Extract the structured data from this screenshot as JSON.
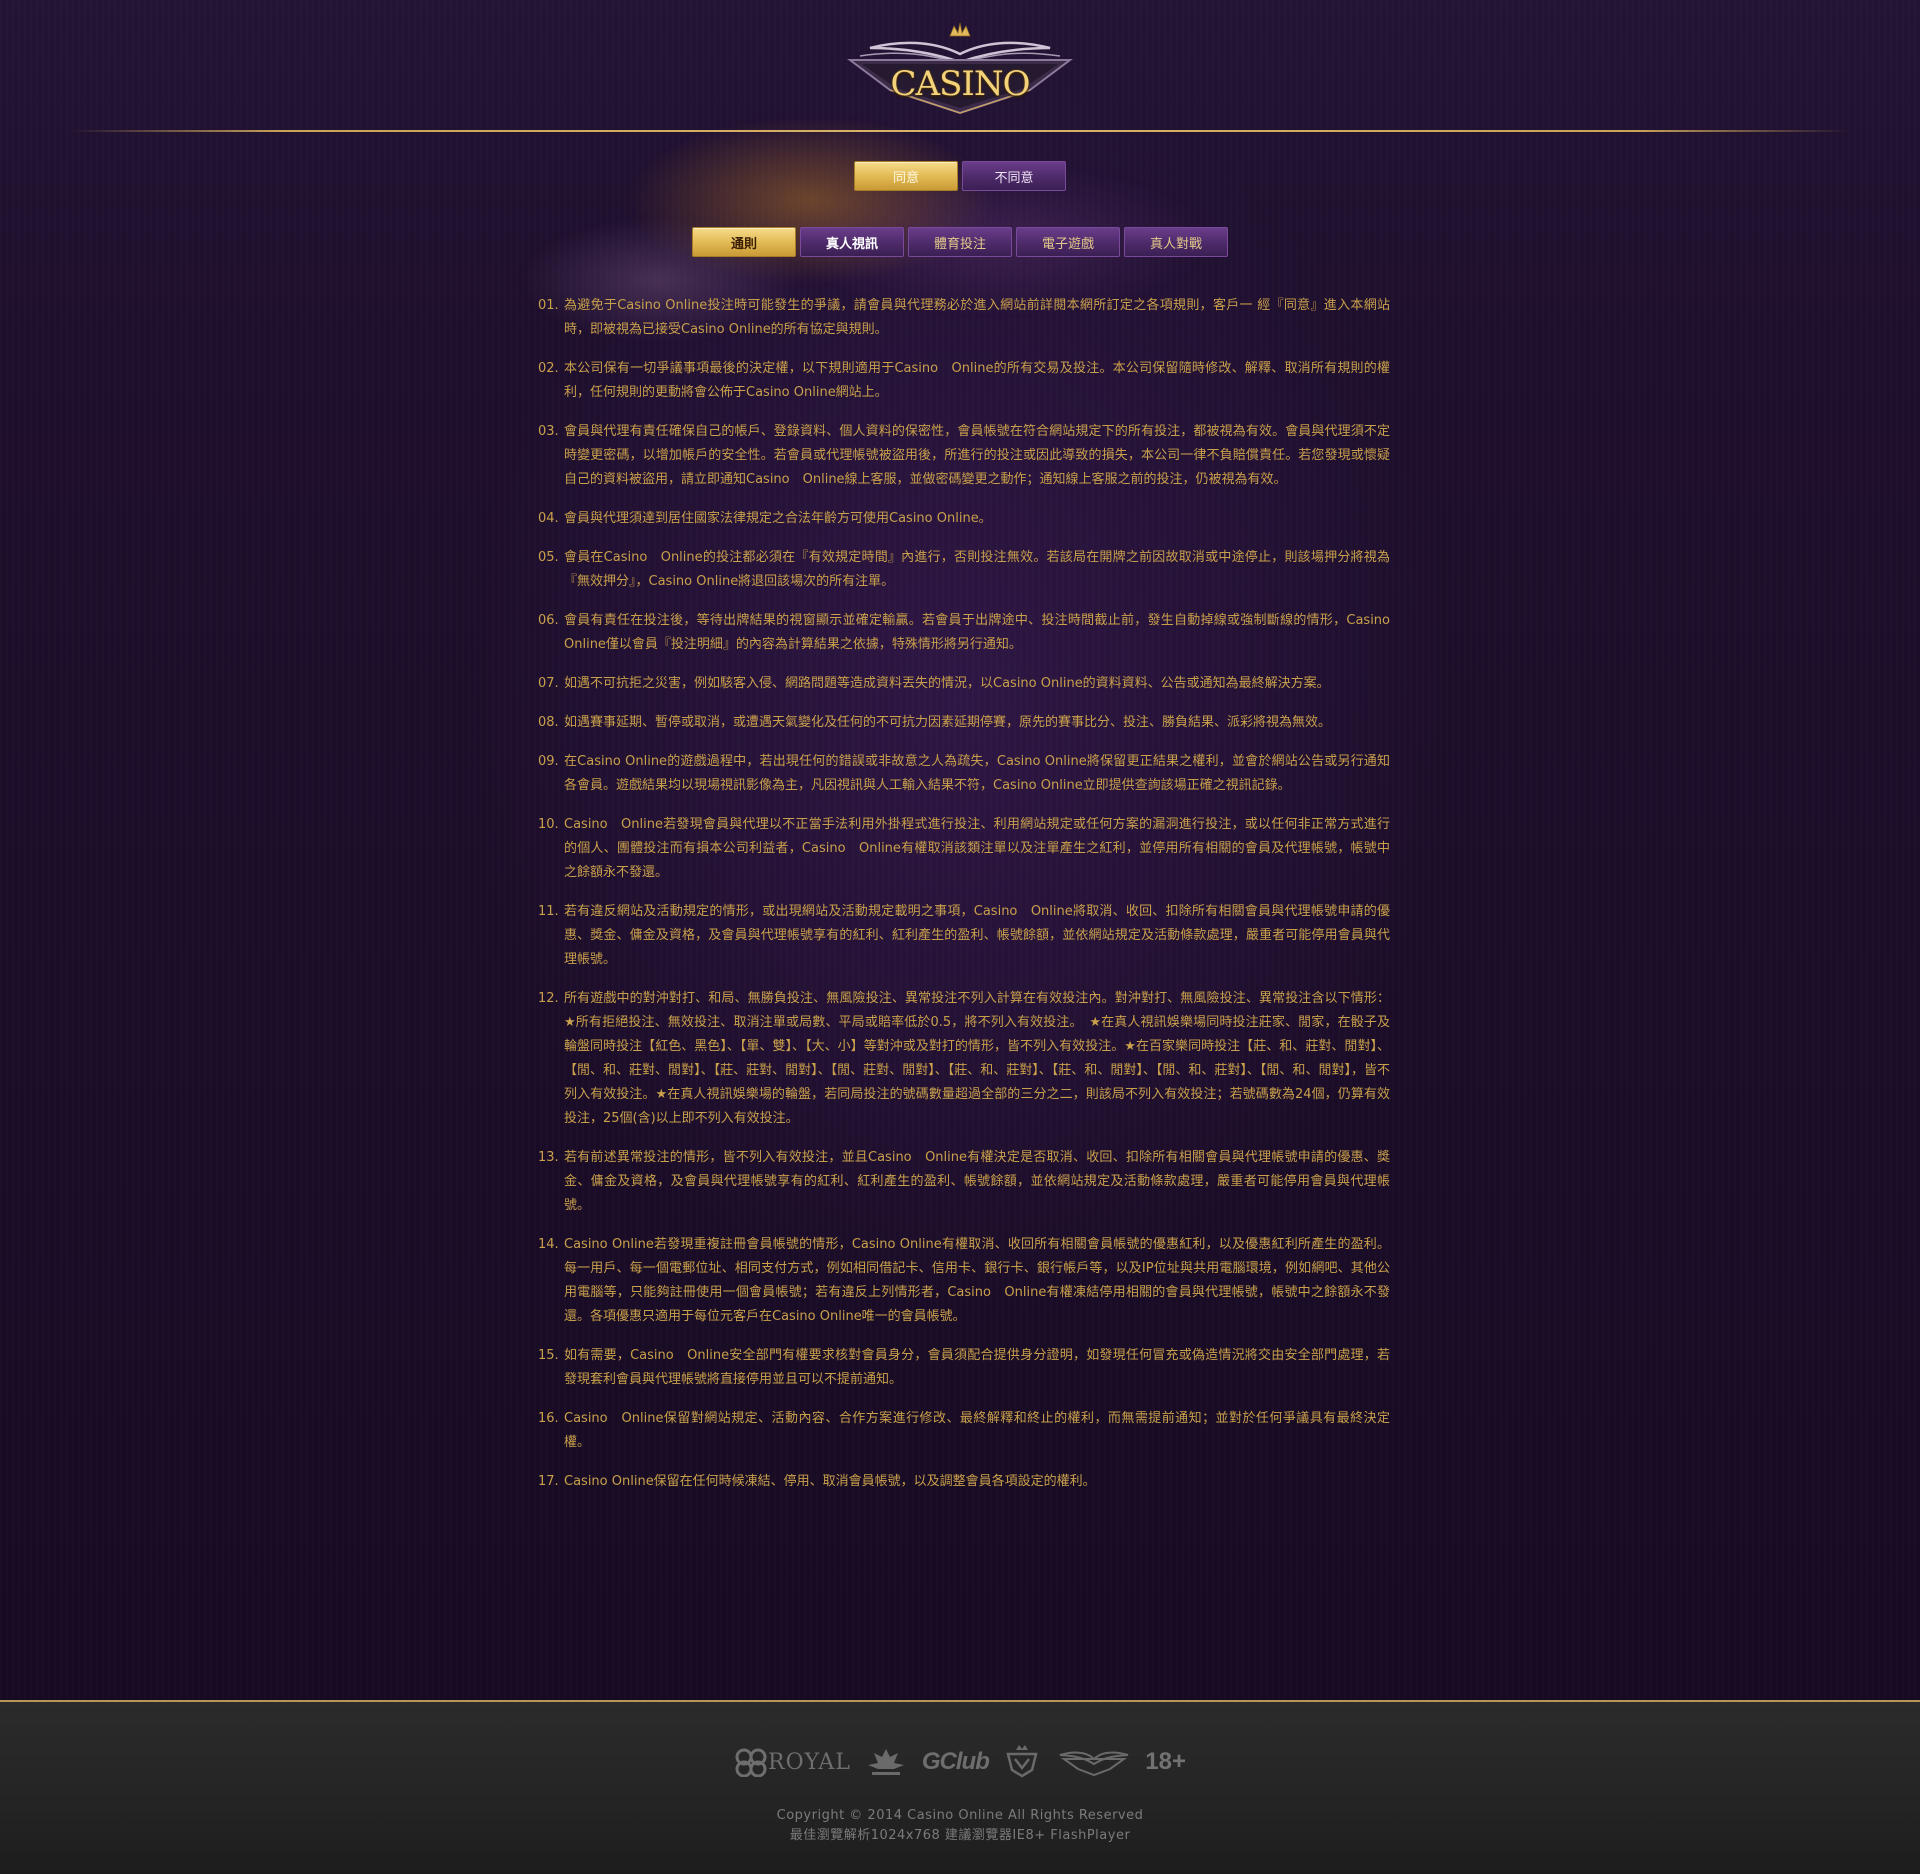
{
  "header": {
    "logo_text": "CASINO"
  },
  "actions": {
    "agree": "同意",
    "disagree": "不同意"
  },
  "tabs": [
    {
      "label": "通則"
    },
    {
      "label": "真人視訊"
    },
    {
      "label": "體育投注"
    },
    {
      "label": "電子遊戲"
    },
    {
      "label": "真人對戰"
    }
  ],
  "rules": [
    {
      "num": "01.",
      "text": "為避免于Casino Online投注時可能發生的爭議，請會員與代理務必於進入網站前詳閱本網所訂定之各項規則，客戶一 經『同意』進入本網站時，即被視為已接受Casino Online的所有協定與規則。"
    },
    {
      "num": "02.",
      "text": "本公司保有一切爭議事項最後的決定權，以下規則適用于Casino　Online的所有交易及投注。本公司保留隨時修改、解釋、取消所有規則的權利，任何規則的更動將會公佈于Casino Online網站上。"
    },
    {
      "num": "03.",
      "text": "會員與代理有責任確保自己的帳戶、登錄資料、個人資料的保密性，會員帳號在符合網站規定下的所有投注，都被視為有效。會員與代理須不定時變更密碼，以增加帳戶的安全性。若會員或代理帳號被盜用後，所進行的投注或因此導致的損失，本公司一律不負賠償責任。若您發現或懷疑自己的資料被盜用，請立即通知Casino　Online線上客服，並做密碼變更之動作；通知線上客服之前的投注，仍被視為有效。"
    },
    {
      "num": "04.",
      "text": "會員與代理須達到居住國家法律規定之合法年齡方可使用Casino Online。"
    },
    {
      "num": "05.",
      "text": "會員在Casino　Online的投注都必須在『有效規定時間』內進行，否則投注無效。若該局在開牌之前因故取消或中途停止，則該場押分將視為『無效押分』，Casino Online將退回該場次的所有注單。"
    },
    {
      "num": "06.",
      "text": "會員有責任在投注後，等待出牌結果的視窗顯示並確定輸贏。若會員于出牌途中、投注時間截止前，發生自動掉線或強制斷線的情形，Casino Online僅以會員『投注明細』的內容為計算結果之依據，特殊情形將另行通知。"
    },
    {
      "num": "07.",
      "text": "如遇不可抗拒之災害，例如駭客入侵、網路問題等造成資料丟失的情況，以Casino Online的資料資料、公告或通知為最終解決方案。"
    },
    {
      "num": "08.",
      "text": "如遇賽事延期、暫停或取消，或遭遇天氣變化及任何的不可抗力因素延期停賽，原先的賽事比分、投注、勝負結果、派彩將視為無效。"
    },
    {
      "num": "09.",
      "text": "在Casino Online的遊戲過程中，若出現任何的錯誤或非故意之人為疏失，Casino Online將保留更正結果之權利，並會於網站公告或另行通知各會員。遊戲結果均以現場視訊影像為主，凡因視訊與人工輸入結果不符，Casino Online立即提供查詢該場正確之視訊記錄。"
    },
    {
      "num": "10.",
      "text": "Casino　Online若發現會員與代理以不正當手法利用外掛程式進行投注、利用網站規定或任何方案的漏洞進行投注，或以任何非正常方式進行的個人、團體投注而有損本公司利益者，Casino　Online有權取消該類注單以及注單產生之紅利，並停用所有相關的會員及代理帳號，帳號中之餘額永不發還。"
    },
    {
      "num": "11.",
      "text": "若有違反網站及活動規定的情形，或出現網站及活動規定載明之事項，Casino　Online將取消、收回、扣除所有相關會員與代理帳號申請的優惠、獎金、傭金及資格，及會員與代理帳號享有的紅利、紅利產生的盈利、帳號餘額，並依網站規定及活動條款處理，嚴重者可能停用會員與代理帳號。"
    },
    {
      "num": "12.",
      "text": "所有遊戲中的對沖對打、和局、無勝負投注、無風險投注、異常投注不列入計算在有效投注內。對沖對打、無風險投注、異常投注含以下情形：★所有拒絕投注、無效投注、取消注單或局數、平局或賠率低於0.5，將不列入有效投注。　★在真人視訊娛樂場同時投注莊家、閒家，在骰子及輪盤同時投注【紅色、黑色】、【單、雙】、【大、小】等對沖或及對打的情形，皆不列入有效投注。★在百家樂同時投注【莊、和、莊對、閒對】、【閒、和、莊對、閒對】、【莊、莊對、閒對】、【閒、莊對、閒對】、【莊、和、莊對】、【莊、和、閒對】、【閒、和、莊對】、【閒、和、閒對】，皆不列入有效投注。★在真人視訊娛樂場的輪盤，若同局投注的號碼數量超過全部的三分之二，則該局不列入有效投注；若號碼數為24個，仍算有效投注，25個(含)以上即不列入有效投注。"
    },
    {
      "num": "13.",
      "text": "若有前述異常投注的情形，皆不列入有效投注，並且Casino　Online有權決定是否取消、收回、扣除所有相關會員與代理帳號申請的優惠、獎金、傭金及資格，及會員與代理帳號享有的紅利、紅利產生的盈利、帳號餘額，並依網站規定及活動條款處理，嚴重者可能停用會員與代理帳號。"
    },
    {
      "num": "14.",
      "text": "Casino Online若發現重複註冊會員帳號的情形，Casino Online有權取消、收回所有相關會員帳號的優惠紅利，以及優惠紅利所產生的盈利。每一用戶、每一個電郵位址、相同支付方式，例如相同借記卡、信用卡、銀行卡、銀行帳戶等，以及IP位址與共用電腦環境，例如網吧、其他公用電腦等，只能夠註冊使用一個會員帳號；若有違反上列情形者，Casino　Online有權凍結停用相關的會員與代理帳號，帳號中之餘額永不發還。各項優惠只適用于每位元客戶在Casino Online唯一的會員帳號。"
    },
    {
      "num": "15.",
      "text": "如有需要，Casino　Online安全部門有權要求核對會員身分，會員須配合提供身分證明，如發現任何冒充或偽造情況將交由安全部門處理，若發現套利會員與代理帳號將直接停用並且可以不提前通知。"
    },
    {
      "num": "16.",
      "text": "Casino　Online保留對網站規定、活動內容、合作方案進行修改、最終解釋和終止的權利，而無需提前通知；並對於任何爭議具有最終決定權。"
    },
    {
      "num": "17.",
      "text": "Casino Online保留在任何時候凍結、停用、取消會員帳號，以及調整會員各項設定的權利。"
    }
  ],
  "footer": {
    "partners": {
      "royal": "ROYAL",
      "gclub": "GClub",
      "age": "18+"
    },
    "copyright": "Copyright © 2014 Casino Online All Rights Reserved",
    "browser_note": "最佳瀏覽解析1024x768 建議瀏覽器IE8+ FlashPlayer"
  }
}
